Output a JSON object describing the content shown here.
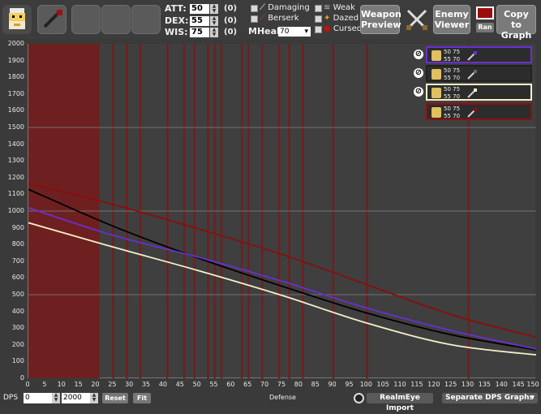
{
  "stats": {
    "att": {
      "label": "ATT:",
      "value": "50",
      "bonus": "(0)"
    },
    "dex": {
      "label": "DEX:",
      "value": "55",
      "bonus": "(0)"
    },
    "wis": {
      "label": "WIS:",
      "value": "75",
      "bonus": "(0)"
    }
  },
  "effects": {
    "damaging": "Damaging",
    "berserk": "Berserk",
    "weak": "Weak",
    "dazed": "Dazed",
    "cursed": "Cursed"
  },
  "mheal": {
    "label": "MHeal:",
    "value": "70"
  },
  "buttons": {
    "weapon_preview": "Weapon Preview",
    "enemy_viewer": "Enemy Viewer",
    "copy_to_graph": "Copy to Graph",
    "ran": "Ran",
    "reset": "Reset",
    "fit": "Fit",
    "realmeye_import": "RealmEye Import",
    "separate_graphs": "Separate DPS Graphs"
  },
  "bottom": {
    "dps_label": "DPS",
    "min_value": "0",
    "max_value": "2000",
    "xaxis_label": "Defense"
  },
  "legend": [
    {
      "line1": "50 75",
      "line2": "55 70",
      "border": "#6a2fd0",
      "weapon": "staff-blue-icon",
      "ignore": true
    },
    {
      "line1": "50 75",
      "line2": "55 70",
      "border": "#222222",
      "weapon": "staff-dark-icon",
      "ignore": true
    },
    {
      "line1": "50 75",
      "line2": "55 70",
      "border": "#f4f0c8",
      "weapon": "staff-gold-icon",
      "ignore": true
    },
    {
      "line1": "50 75",
      "line2": "55 70",
      "border": "#8b1010",
      "weapon": "staff-red-icon",
      "ignore": false
    }
  ],
  "colors": {
    "red_series": "#8b0d0d",
    "black_series": "#000000",
    "purple_series": "#6a2fd0",
    "cream_series": "#f4f0c8",
    "red_band": "#6e2020",
    "ran_swatch": "#9a0d0d"
  },
  "chart_data": {
    "type": "line",
    "xlabel": "Defense",
    "ylabel": "DPS",
    "xlim": [
      0,
      150
    ],
    "ylim": [
      0,
      2000
    ],
    "x_ticks": [
      0,
      5,
      10,
      15,
      20,
      25,
      30,
      35,
      40,
      45,
      50,
      55,
      60,
      65,
      70,
      75,
      80,
      85,
      90,
      95,
      100,
      105,
      110,
      115,
      120,
      125,
      130,
      135,
      140,
      145,
      150
    ],
    "y_ticks": [
      0,
      100,
      200,
      300,
      400,
      500,
      600,
      700,
      800,
      900,
      1000,
      1100,
      1200,
      1300,
      1400,
      1500,
      1600,
      1700,
      1800,
      1900,
      2000
    ],
    "shaded_x_ranges": [
      [
        0,
        21
      ]
    ],
    "highlight_x": [
      25,
      29,
      33,
      41,
      46,
      49,
      53,
      55,
      57,
      63,
      65,
      69,
      74,
      77,
      81,
      90,
      100,
      130
    ],
    "x": [
      0,
      25,
      50,
      75,
      100,
      125,
      150
    ],
    "series": [
      {
        "color": "#8b0d0d",
        "values": [
          1165,
          1040,
          895,
          740,
          560,
          380,
          245
        ]
      },
      {
        "color": "#000000",
        "values": [
          1130,
          910,
          720,
          550,
          390,
          260,
          170
        ]
      },
      {
        "color": "#6a2fd0",
        "values": [
          1020,
          855,
          725,
          580,
          420,
          285,
          175
        ]
      },
      {
        "color": "#f4f0c8",
        "values": [
          930,
          785,
          645,
          495,
          330,
          200,
          140
        ]
      }
    ]
  }
}
